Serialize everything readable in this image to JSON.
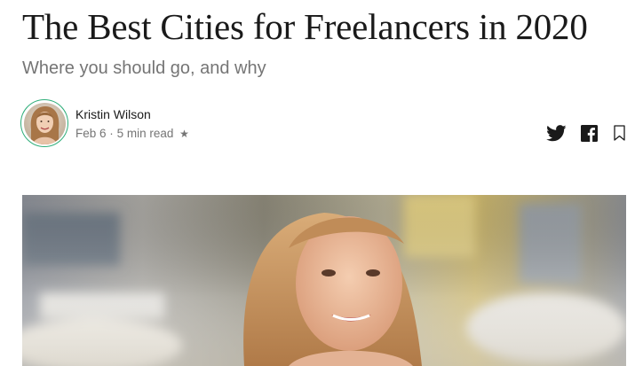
{
  "article": {
    "title": "The Best Cities for Freelancers in 2020",
    "subtitle": "Where you should go, and why"
  },
  "author": {
    "name": "Kristin Wilson",
    "date": "Feb 6",
    "separator": "·",
    "read_time": "5 min read",
    "member_star": "★"
  },
  "share": {
    "twitter_icon": "twitter-icon",
    "facebook_icon": "facebook-icon",
    "bookmark_icon": "bookmark-icon"
  },
  "colors": {
    "title_text": "#1a1a1a",
    "muted_text": "#757575",
    "avatar_ring": "#2fae7a"
  }
}
